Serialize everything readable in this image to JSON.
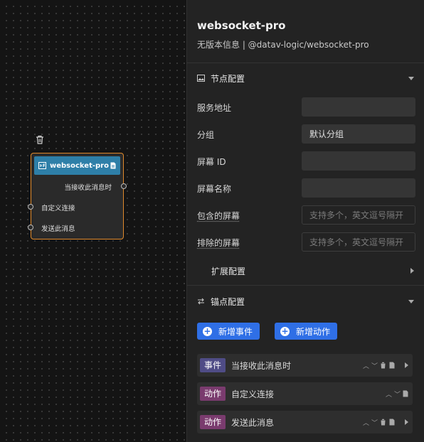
{
  "node": {
    "title": "websocket-pro",
    "outputs": [
      "当接收此消息时"
    ],
    "inputs": [
      "自定义连接",
      "发送此消息"
    ]
  },
  "panel": {
    "title": "websocket-pro",
    "subtitle": "无版本信息 | @datav-logic/websocket-pro",
    "node_config": {
      "label": "节点配置",
      "fields": [
        {
          "label": "服务地址",
          "value": "",
          "placeholder": ""
        },
        {
          "label": "分组",
          "value": "默认分组",
          "placeholder": ""
        },
        {
          "label": "屏幕 ID",
          "value": "",
          "placeholder": ""
        },
        {
          "label": "屏幕名称",
          "value": "",
          "placeholder": ""
        },
        {
          "label": "包含的屏幕",
          "value": "",
          "placeholder": "支持多个，英文逗号隔开"
        },
        {
          "label": "排除的屏幕",
          "value": "",
          "placeholder": "支持多个，英文逗号隔开"
        }
      ],
      "extended": "扩展配置"
    },
    "anchor_config": {
      "label": "锚点配置",
      "add_event": "新增事件",
      "add_action": "新增动作",
      "rows": [
        {
          "type": "事件",
          "text": "当接收此消息时"
        },
        {
          "type": "动作",
          "text": "自定义连接"
        },
        {
          "type": "动作",
          "text": "发送此消息"
        }
      ]
    }
  },
  "colors": {
    "accent": "#2f6fe6",
    "node_header": "#2e7fa8",
    "node_border": "#e08a2c",
    "event_tag": "#4f4c86",
    "action_tag": "#7a3b6e"
  }
}
